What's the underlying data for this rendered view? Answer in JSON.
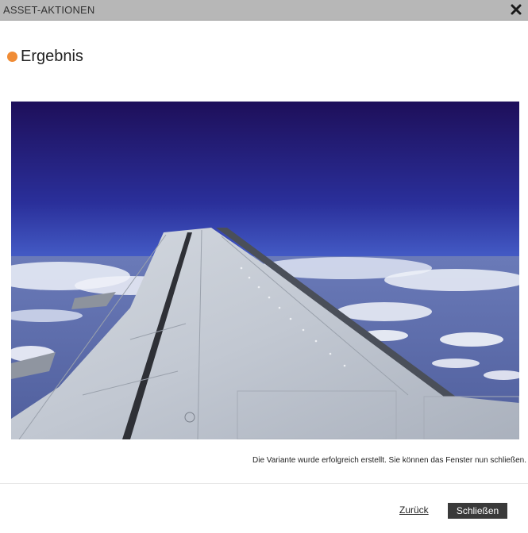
{
  "window": {
    "title": "ASSET-AKTIONEN",
    "close_icon": "close-icon"
  },
  "result": {
    "heading": "Ergebnis",
    "accent_color": "#f08c35"
  },
  "message": "Die Variante wurde erfolgreich erstellt. Sie können das Fenster nun schließen.",
  "footer": {
    "back_label": "Zurück",
    "close_label": "Schließen"
  }
}
